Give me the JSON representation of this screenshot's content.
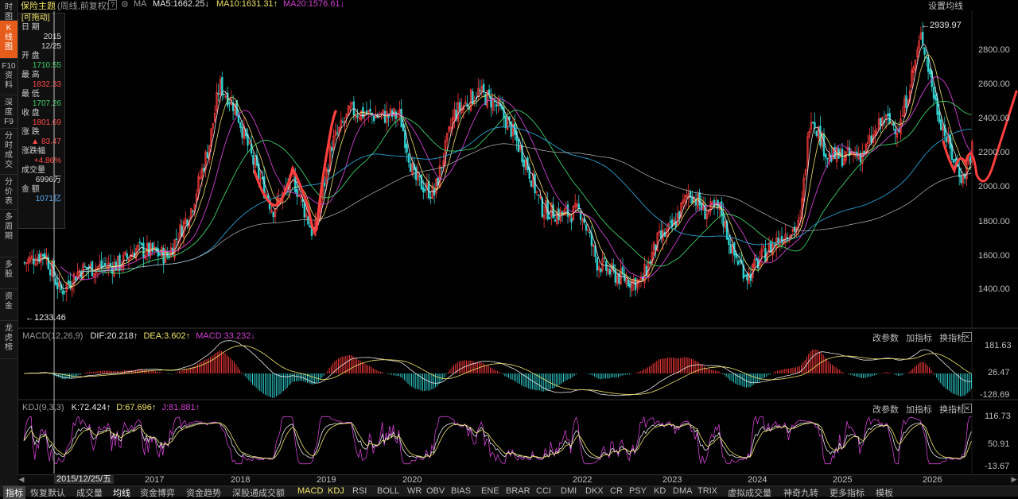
{
  "nav_tabs": [
    {
      "label": "时图",
      "chars": [
        "时",
        "图"
      ]
    },
    {
      "label": "K线图",
      "chars": [
        "K",
        "线",
        "图"
      ],
      "active": true
    },
    {
      "label": "F10资料",
      "chars": [
        "F10",
        "资",
        "料"
      ]
    },
    {
      "label": "深度F9",
      "chars": [
        "深",
        "度",
        "F9"
      ]
    },
    {
      "label": "分时成交",
      "chars": [
        "分",
        "时",
        "成",
        "交"
      ]
    },
    {
      "label": "分价表",
      "chars": [
        "分",
        "价",
        "表"
      ]
    },
    {
      "label": "多周期",
      "chars": [
        "多",
        "周",
        "期"
      ]
    },
    {
      "label": "多股",
      "chars": [
        "多",
        "股"
      ]
    },
    {
      "label": "资金",
      "chars": [
        "资",
        "金"
      ]
    },
    {
      "label": "龙虎榜",
      "chars": [
        "龙",
        "虎",
        "榜"
      ]
    }
  ],
  "header": {
    "title": "保险主题",
    "subtitle": "(周线,前复权)",
    "help": "?",
    "ma_label": "MA",
    "ma5": "MA5:1662.25",
    "ma10": "MA10:1631.31",
    "ma20": "MA20:1576.61",
    "settings": "设置均线"
  },
  "info_panel": {
    "drag": "[可拖动]",
    "date_label": "日 期",
    "date_year": "2015",
    "date_md": "12/25",
    "open_label": "开 盘",
    "open": "1710.55",
    "high_label": "最 高",
    "high": "1832.33",
    "low_label": "最 低",
    "low": "1707.26",
    "close_label": "收 盘",
    "close": "1801.69",
    "change_label": "涨 跌",
    "change": "▲ 83.47",
    "pct_label": "涨跌幅",
    "pct": "+4.86%",
    "vol_label": "成交量",
    "vol": "6996万",
    "amt_label": "金 额",
    "amt": "1071亿"
  },
  "main_chart": {
    "high_marker": "←2939.97",
    "low_marker": "←1233.46",
    "y_ticks": [
      "2800.00",
      "2600.00",
      "2400.00",
      "2200.00",
      "2000.00",
      "1800.00",
      "1600.00",
      "1400.00"
    ]
  },
  "macd_panel": {
    "name": "MACD(12,26,9)",
    "dif": "DIF:20.218",
    "dea": "DEA:3.602",
    "macd": "MACD:33.232",
    "actions": [
      "改参数",
      "加指标",
      "换指标"
    ],
    "y_ticks": [
      "181.63",
      "26.47",
      "-128.69"
    ]
  },
  "kdj_panel": {
    "name": "KDJ(9,3,3)",
    "k": "K:72.424",
    "d": "D:67.696",
    "j": "J:81.881",
    "actions": [
      "改参数",
      "加指标",
      "换指标"
    ],
    "y_ticks": [
      "116.73",
      "50.91",
      "-13.67"
    ]
  },
  "time_axis": {
    "cursor_date": "2015/12/25/五",
    "years": [
      "2017",
      "2018",
      "2019",
      "2020",
      "2022",
      "2023",
      "2024",
      "2025",
      "2026"
    ]
  },
  "indicator_bar": [
    "指标",
    "恢复默认",
    "成交量",
    "均线",
    "资金博弈",
    "资金趋势",
    "深股通成交额",
    "MACD",
    "KDJ",
    "RSI",
    "BOLL",
    "WR",
    "OBV",
    "BIAS",
    "ENE",
    "BRAR",
    "CCI",
    "DMI",
    "DKX",
    "CR",
    "PSY",
    "KD",
    "DMA",
    "TRIX",
    "虚拟成交量",
    "神奇九转",
    "更多指标",
    "模板"
  ],
  "colors": {
    "up": "#ff3b3b",
    "down": "#2fd0d0",
    "ma5": "#e8e8e8",
    "ma10": "#f0e36a",
    "ma20": "#d040d0",
    "ma_long": "#3fcf6a",
    "ma_longer": "#2b9fd0",
    "accent": "#e65c1a"
  }
}
